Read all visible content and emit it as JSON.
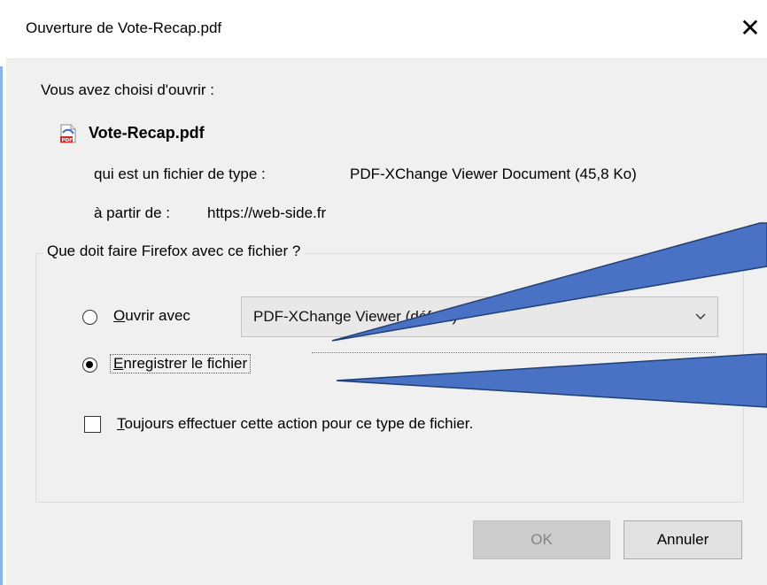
{
  "dialog": {
    "title": "Ouverture de Vote-Recap.pdf",
    "close_glyph": "✕",
    "intro": "Vous avez choisi d'ouvrir :",
    "file": {
      "icon": "pdf-file-icon",
      "name": "Vote-Recap.pdf",
      "type_label": "qui est un fichier de type :",
      "type_value": "PDF-XChange Viewer Document (45,8 Ko)",
      "from_label": "à partir de :",
      "from_value": "https://web-side.fr"
    },
    "group": {
      "legend": "Que doit faire Firefox avec ce fichier ?",
      "open_with": {
        "accel": "O",
        "rest": "uvrir avec",
        "selected": false,
        "app": "PDF-XChange Viewer (défaut)"
      },
      "save_file": {
        "accel": "E",
        "rest": "nregistrer le fichier",
        "selected": true
      },
      "always": {
        "accel": "T",
        "rest": "oujours effectuer cette action pour ce type de fichier.",
        "checked": false
      }
    },
    "buttons": {
      "ok": "OK",
      "cancel": "Annuler"
    }
  },
  "colors": {
    "dialog_bg": "#f0f0f0",
    "titlebar_bg": "#ffffff",
    "ok_disabled_bg": "#cccccc",
    "callout_fill": "#4a72c4",
    "callout_stroke": "#1f3f78"
  }
}
